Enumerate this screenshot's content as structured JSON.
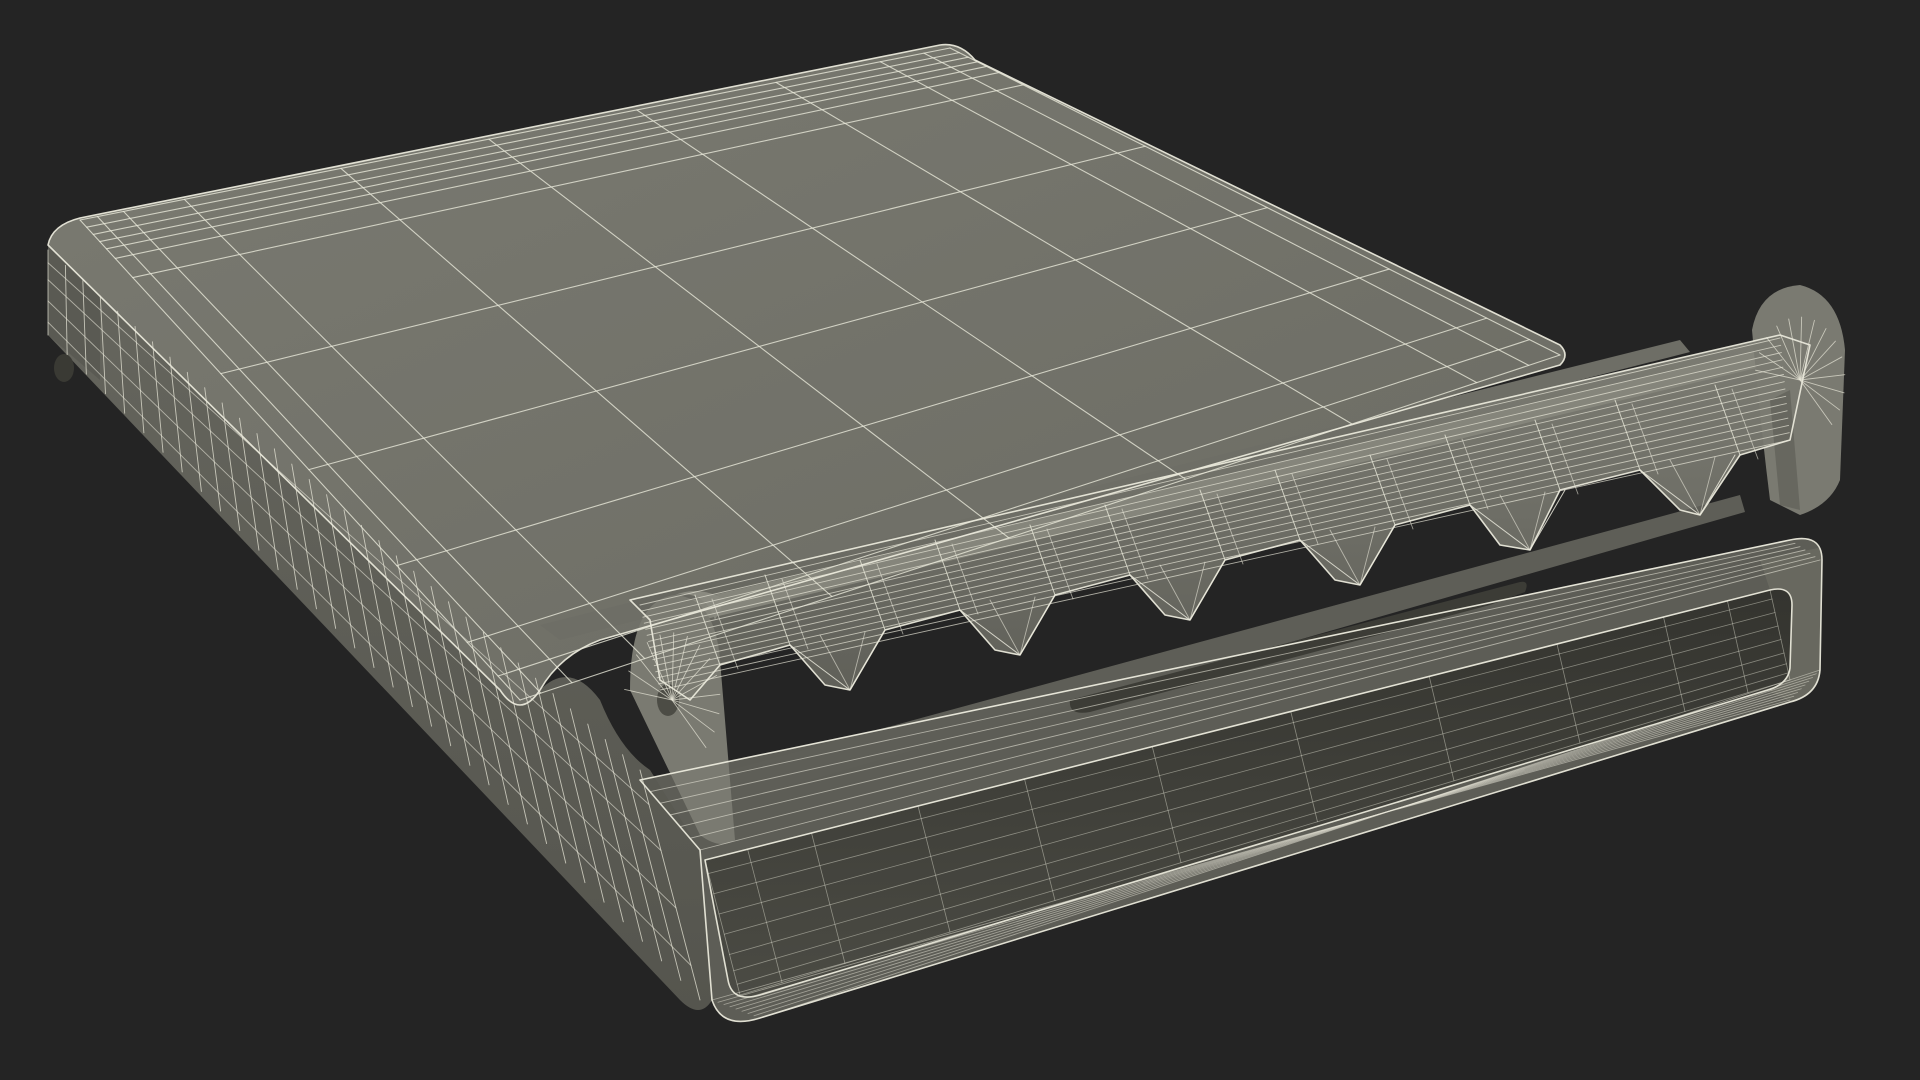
{
  "scene": {
    "kind": "3d-wireframe-render",
    "subject": "buckle-clip-model",
    "colors": {
      "background": "#242424",
      "surface_top": "#73736a",
      "surface_mid": "#6a6a62",
      "surface_dark": "#4f4f48",
      "surface_inner": "#3e3e38",
      "wire": "#e9e8da"
    }
  }
}
